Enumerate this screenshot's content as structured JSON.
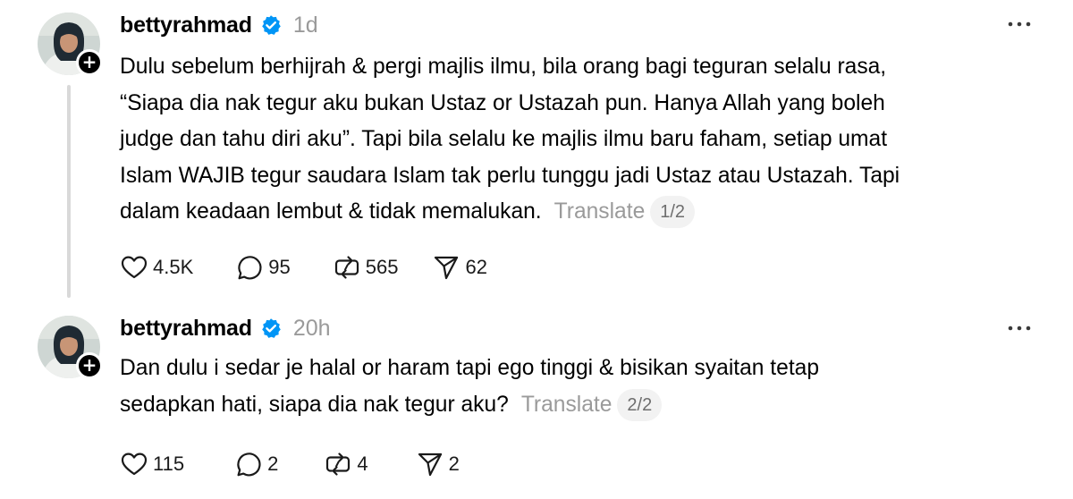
{
  "icons": {
    "verified": "verified-badge-icon",
    "more": "more-horizontal-icon",
    "like": "heart-icon",
    "reply": "speech-bubble-icon",
    "repost": "repost-icon",
    "share": "send-paper-plane-icon",
    "follow": "plus-icon"
  },
  "colors": {
    "verified": "#0095f6",
    "secondary_text": "#9a9a9a",
    "thread_line": "#d9d9d9"
  },
  "posts": [
    {
      "username": "bettyrahmad",
      "timestamp": "1d",
      "follow_symbol": "+",
      "body_lines": [
        "Dulu sebelum berhijrah & pergi majlis ilmu, bila orang bagi teguran selalu rasa,",
        "“Siapa dia nak tegur aku bukan Ustaz or Ustazah pun. Hanya Allah yang boleh",
        "judge dan tahu diri aku”. Tapi bila selalu ke majlis ilmu baru faham, setiap umat",
        "Islam WAJIB tegur saudara Islam tak perlu tunggu jadi Ustaz atau Ustazah. Tapi",
        "dalam keadaan lembut & tidak memalukan."
      ],
      "translate_label": "Translate",
      "page_indicator": "1/2",
      "likes": "4.5K",
      "replies": "95",
      "reposts": "565",
      "shares": "62"
    },
    {
      "username": "bettyrahmad",
      "timestamp": "20h",
      "follow_symbol": "+",
      "body_lines": [
        "Dan dulu i sedar je halal or haram tapi ego tinggi & bisikan syaitan tetap",
        "sedapkan hati, siapa dia nak tegur aku?"
      ],
      "translate_label": "Translate",
      "page_indicator": "2/2",
      "likes": "115",
      "replies": "2",
      "reposts": "4",
      "shares": "2"
    }
  ]
}
